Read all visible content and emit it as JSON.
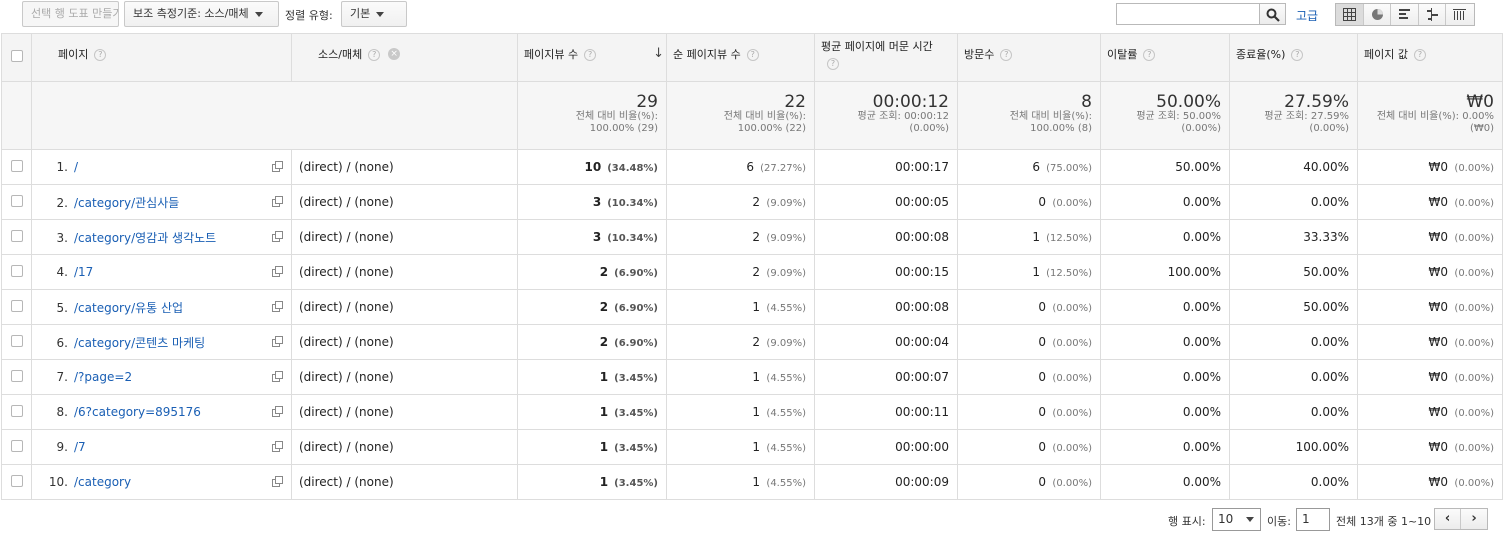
{
  "toolbar": {
    "make_chart_label": "선택 행 도표 만들기",
    "secondary_dim_label": "보조 측정기준: 소스/매체",
    "sort_type_label": "정렬 유형:",
    "sort_value": "기본",
    "search_value": "",
    "advanced_label": "고급",
    "view_icons": [
      "table-view-icon",
      "pie-view-icon",
      "bar-view-icon",
      "comparison-view-icon",
      "pivot-view-icon"
    ],
    "active_view": "table-view-icon"
  },
  "columns": {
    "page": "페이지",
    "source": "소스/매체",
    "pageviews": "페이지뷰 수",
    "unique_pageviews": "순 페이지뷰 수",
    "avg_time": "평균 페이지에 머문 시간",
    "entrances": "방문수",
    "bounce": "이탈률",
    "exit": "종료율(%)",
    "page_value": "페이지 값",
    "help_glyph": "?",
    "sort_glyph": "↓",
    "remove_glyph": "×"
  },
  "totals": {
    "pageviews": {
      "value": "29",
      "sub1": "전체 대비 비율(%):",
      "sub2": "100.00% (29)"
    },
    "unique_pageviews": {
      "value": "22",
      "sub1": "전체 대비 비율(%):",
      "sub2": "100.00% (22)"
    },
    "avg_time": {
      "value": "00:00:12",
      "sub1": "평균 조회: 00:00:12",
      "sub2": "(0.00%)"
    },
    "entrances": {
      "value": "8",
      "sub1": "전체 대비 비율(%):",
      "sub2": "100.00% (8)"
    },
    "bounce": {
      "value": "50.00%",
      "sub1": "평균 조회: 50.00%",
      "sub2": "(0.00%)"
    },
    "exit": {
      "value": "27.59%",
      "sub1": "평균 조회: 27.59%",
      "sub2": "(0.00%)"
    },
    "page_value": {
      "value": "₩0",
      "sub1": "전체 대비 비율(%): 0.00%",
      "sub2": "(₩0)"
    }
  },
  "rows": [
    {
      "rank": "1.",
      "page": "/",
      "source": "(direct) / (none)",
      "pv": "10",
      "pv_pct": "(34.48%)",
      "upv": "6",
      "upv_pct": "(27.27%)",
      "time": "00:00:17",
      "ent": "6",
      "ent_pct": "(75.00%)",
      "bounce": "50.00%",
      "exit": "40.00%",
      "val": "₩0",
      "val_pct": "(0.00%)"
    },
    {
      "rank": "2.",
      "page": "/category/관심사들",
      "source": "(direct) / (none)",
      "pv": "3",
      "pv_pct": "(10.34%)",
      "upv": "2",
      "upv_pct": "(9.09%)",
      "time": "00:00:05",
      "ent": "0",
      "ent_pct": "(0.00%)",
      "bounce": "0.00%",
      "exit": "0.00%",
      "val": "₩0",
      "val_pct": "(0.00%)"
    },
    {
      "rank": "3.",
      "page": "/category/영감과 생각노트",
      "source": "(direct) / (none)",
      "pv": "3",
      "pv_pct": "(10.34%)",
      "upv": "2",
      "upv_pct": "(9.09%)",
      "time": "00:00:08",
      "ent": "1",
      "ent_pct": "(12.50%)",
      "bounce": "0.00%",
      "exit": "33.33%",
      "val": "₩0",
      "val_pct": "(0.00%)"
    },
    {
      "rank": "4.",
      "page": "/17",
      "source": "(direct) / (none)",
      "pv": "2",
      "pv_pct": "(6.90%)",
      "upv": "2",
      "upv_pct": "(9.09%)",
      "time": "00:00:15",
      "ent": "1",
      "ent_pct": "(12.50%)",
      "bounce": "100.00%",
      "exit": "50.00%",
      "val": "₩0",
      "val_pct": "(0.00%)"
    },
    {
      "rank": "5.",
      "page": "/category/유통 산업",
      "source": "(direct) / (none)",
      "pv": "2",
      "pv_pct": "(6.90%)",
      "upv": "1",
      "upv_pct": "(4.55%)",
      "time": "00:00:08",
      "ent": "0",
      "ent_pct": "(0.00%)",
      "bounce": "0.00%",
      "exit": "50.00%",
      "val": "₩0",
      "val_pct": "(0.00%)"
    },
    {
      "rank": "6.",
      "page": "/category/콘텐츠 마케팅",
      "source": "(direct) / (none)",
      "pv": "2",
      "pv_pct": "(6.90%)",
      "upv": "2",
      "upv_pct": "(9.09%)",
      "time": "00:00:04",
      "ent": "0",
      "ent_pct": "(0.00%)",
      "bounce": "0.00%",
      "exit": "0.00%",
      "val": "₩0",
      "val_pct": "(0.00%)"
    },
    {
      "rank": "7.",
      "page": "/?page=2",
      "source": "(direct) / (none)",
      "pv": "1",
      "pv_pct": "(3.45%)",
      "upv": "1",
      "upv_pct": "(4.55%)",
      "time": "00:00:07",
      "ent": "0",
      "ent_pct": "(0.00%)",
      "bounce": "0.00%",
      "exit": "0.00%",
      "val": "₩0",
      "val_pct": "(0.00%)"
    },
    {
      "rank": "8.",
      "page": "/6?category=895176",
      "source": "(direct) / (none)",
      "pv": "1",
      "pv_pct": "(3.45%)",
      "upv": "1",
      "upv_pct": "(4.55%)",
      "time": "00:00:11",
      "ent": "0",
      "ent_pct": "(0.00%)",
      "bounce": "0.00%",
      "exit": "0.00%",
      "val": "₩0",
      "val_pct": "(0.00%)"
    },
    {
      "rank": "9.",
      "page": "/7",
      "source": "(direct) / (none)",
      "pv": "1",
      "pv_pct": "(3.45%)",
      "upv": "1",
      "upv_pct": "(4.55%)",
      "time": "00:00:00",
      "ent": "0",
      "ent_pct": "(0.00%)",
      "bounce": "0.00%",
      "exit": "100.00%",
      "val": "₩0",
      "val_pct": "(0.00%)"
    },
    {
      "rank": "10.",
      "page": "/category",
      "source": "(direct) / (none)",
      "pv": "1",
      "pv_pct": "(3.45%)",
      "upv": "1",
      "upv_pct": "(4.55%)",
      "time": "00:00:09",
      "ent": "0",
      "ent_pct": "(0.00%)",
      "bounce": "0.00%",
      "exit": "0.00%",
      "val": "₩0",
      "val_pct": "(0.00%)"
    }
  ],
  "footer": {
    "rows_label": "행 표시:",
    "rows_value": "10",
    "goto_label": "이동:",
    "goto_value": "1",
    "range_text": "전체 13개 중 1~10",
    "prev_glyph": "‹",
    "next_glyph": "›"
  },
  "colors": {
    "link": "#1a5fb4",
    "header_bg": "#f4f4f4",
    "total_bg": "#f6f6f6",
    "border": "#dddddd"
  }
}
